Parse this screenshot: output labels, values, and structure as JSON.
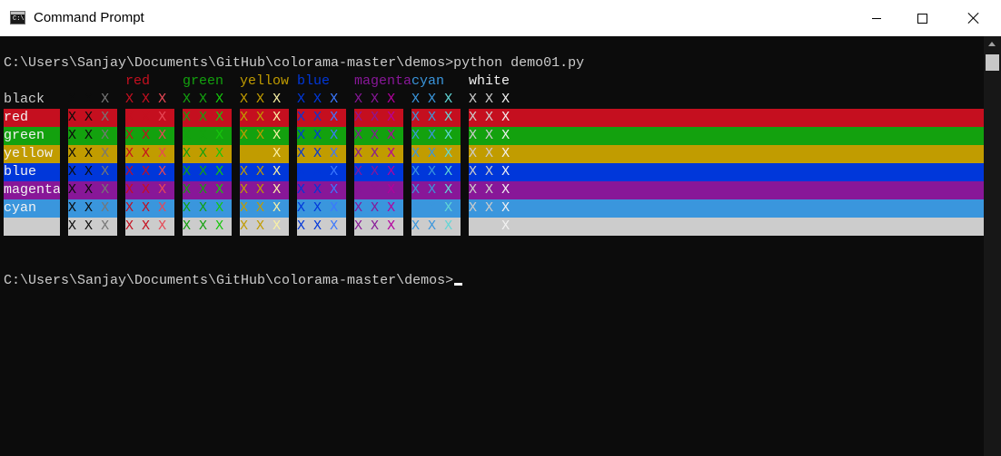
{
  "window": {
    "title": "Command Prompt",
    "icon_text": "C:\\."
  },
  "console": {
    "prompt_command": "C:\\Users\\Sanjay\\Documents\\GitHub\\colorama-master\\demos>python demo01.py",
    "prompt_final": "C:\\Users\\Sanjay\\Documents\\GitHub\\colorama-master\\demos>"
  },
  "colors": {
    "black": "#0c0c0c",
    "red": "#c50f1f",
    "green": "#13a10e",
    "yellow": "#c19c00",
    "blue": "#0037da",
    "magenta": "#881798",
    "cyan": "#3a96dd",
    "white": "#cccccc",
    "bright_black": "#767676",
    "bright_red": "#e74856",
    "bright_green": "#16c60c",
    "bright_yellow": "#f9f1a5",
    "bright_blue": "#3b78ff",
    "bright_magenta": "#b4009e",
    "bright_cyan": "#61d6d6",
    "bright_white": "#f2f2f2"
  },
  "table": {
    "column_headers": [
      "",
      "red",
      "green",
      "yellow",
      "blue",
      "magenta",
      "cyan",
      "white"
    ],
    "cell_text": "X X X",
    "rows": [
      {
        "label": "black",
        "bg": "black"
      },
      {
        "label": "red",
        "bg": "red"
      },
      {
        "label": "green",
        "bg": "green"
      },
      {
        "label": "yellow",
        "bg": "yellow"
      },
      {
        "label": "blue",
        "bg": "blue"
      },
      {
        "label": "magenta",
        "bg": "magenta"
      },
      {
        "label": "cyan",
        "bg": "cyan"
      },
      {
        "label": "",
        "bg": "white"
      }
    ]
  }
}
